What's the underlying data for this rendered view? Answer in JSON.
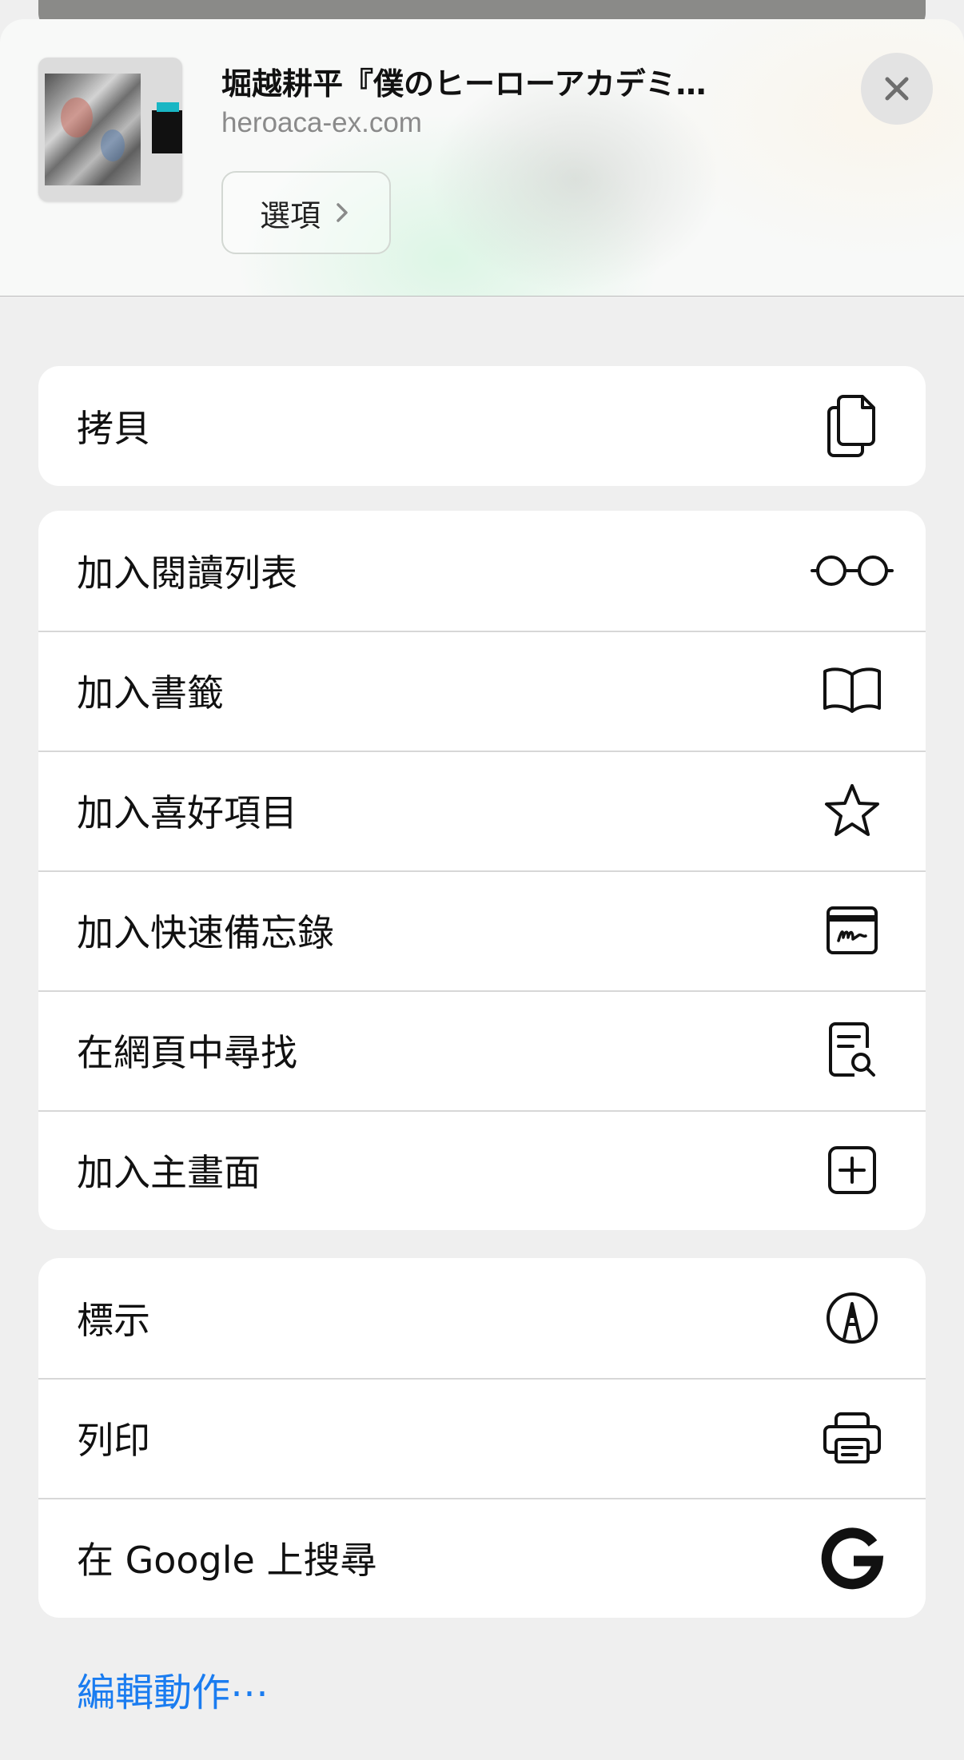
{
  "header": {
    "title": "堀越耕平『僕のヒーローアカデミ…",
    "domain": "heroaca-ex.com",
    "options_label": "選項",
    "thumbnail_icon": "webpage-thumbnail"
  },
  "groups": [
    {
      "items": [
        {
          "label": "拷貝",
          "icon": "copy-icon"
        }
      ]
    },
    {
      "items": [
        {
          "label": "加入閱讀列表",
          "icon": "glasses-icon"
        },
        {
          "label": "加入書籤",
          "icon": "book-icon"
        },
        {
          "label": "加入喜好項目",
          "icon": "star-icon"
        },
        {
          "label": "加入快速備忘錄",
          "icon": "quick-note-icon"
        },
        {
          "label": "在網頁中尋找",
          "icon": "find-in-page-icon"
        },
        {
          "label": "加入主畫面",
          "icon": "add-square-icon"
        }
      ]
    },
    {
      "items": [
        {
          "label": "標示",
          "icon": "markup-icon"
        },
        {
          "label": "列印",
          "icon": "printer-icon"
        },
        {
          "label": "在 Google 上搜尋",
          "icon": "google-icon"
        }
      ]
    }
  ],
  "footer": {
    "edit_actions_label": "編輯動作⋯"
  },
  "colors": {
    "accent": "#1a7cf0",
    "sheet_background": "#efefef",
    "row_background": "#ffffff",
    "separator": "#d7d7d7"
  }
}
